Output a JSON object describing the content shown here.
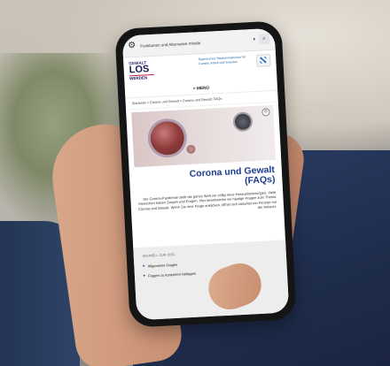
{
  "topbar": {
    "label": "Funktionen und Alternative Inhalte",
    "gear_icon": "gear-icon",
    "chevron_icon": "chevron-down-icon",
    "search_icon": "search-icon"
  },
  "logo": {
    "line1": "GEWALT",
    "line2": "LOS",
    "line3": "WERDEN"
  },
  "ministry": {
    "text": "Bayerisches Staatsministerium für Familie, Arbeit und Soziales",
    "crest_icon": "coat-of-arms-icon"
  },
  "menu": {
    "label": "≡ MENÜ"
  },
  "breadcrumb": "Startseite > Corona und Gewalt > Corona und Gewalt: FAQs",
  "hero": {
    "info_icon": "info-icon",
    "info_glyph": "©"
  },
  "title": {
    "line1": "Corona und Gewalt",
    "line2": "(FAQs)"
  },
  "intro": "Die Corona-Pandemie stellt die ganze Welt vor völlig neue Herausforderungen. Viele Menschen haben Sorgen und Fragen. Hier beantworten wir häufige Fragen zum Thema Corona und Gewalt. Wenn Sie eine Frage anklicken, öffnet sich darunter ein Fenster mit der Antwort.",
  "quick": {
    "heading": "SCHNELL ZUR ZIEL:",
    "items": [
      "Allgemeine Fragen",
      "Fragen zu konkreten Notlagen"
    ]
  }
}
